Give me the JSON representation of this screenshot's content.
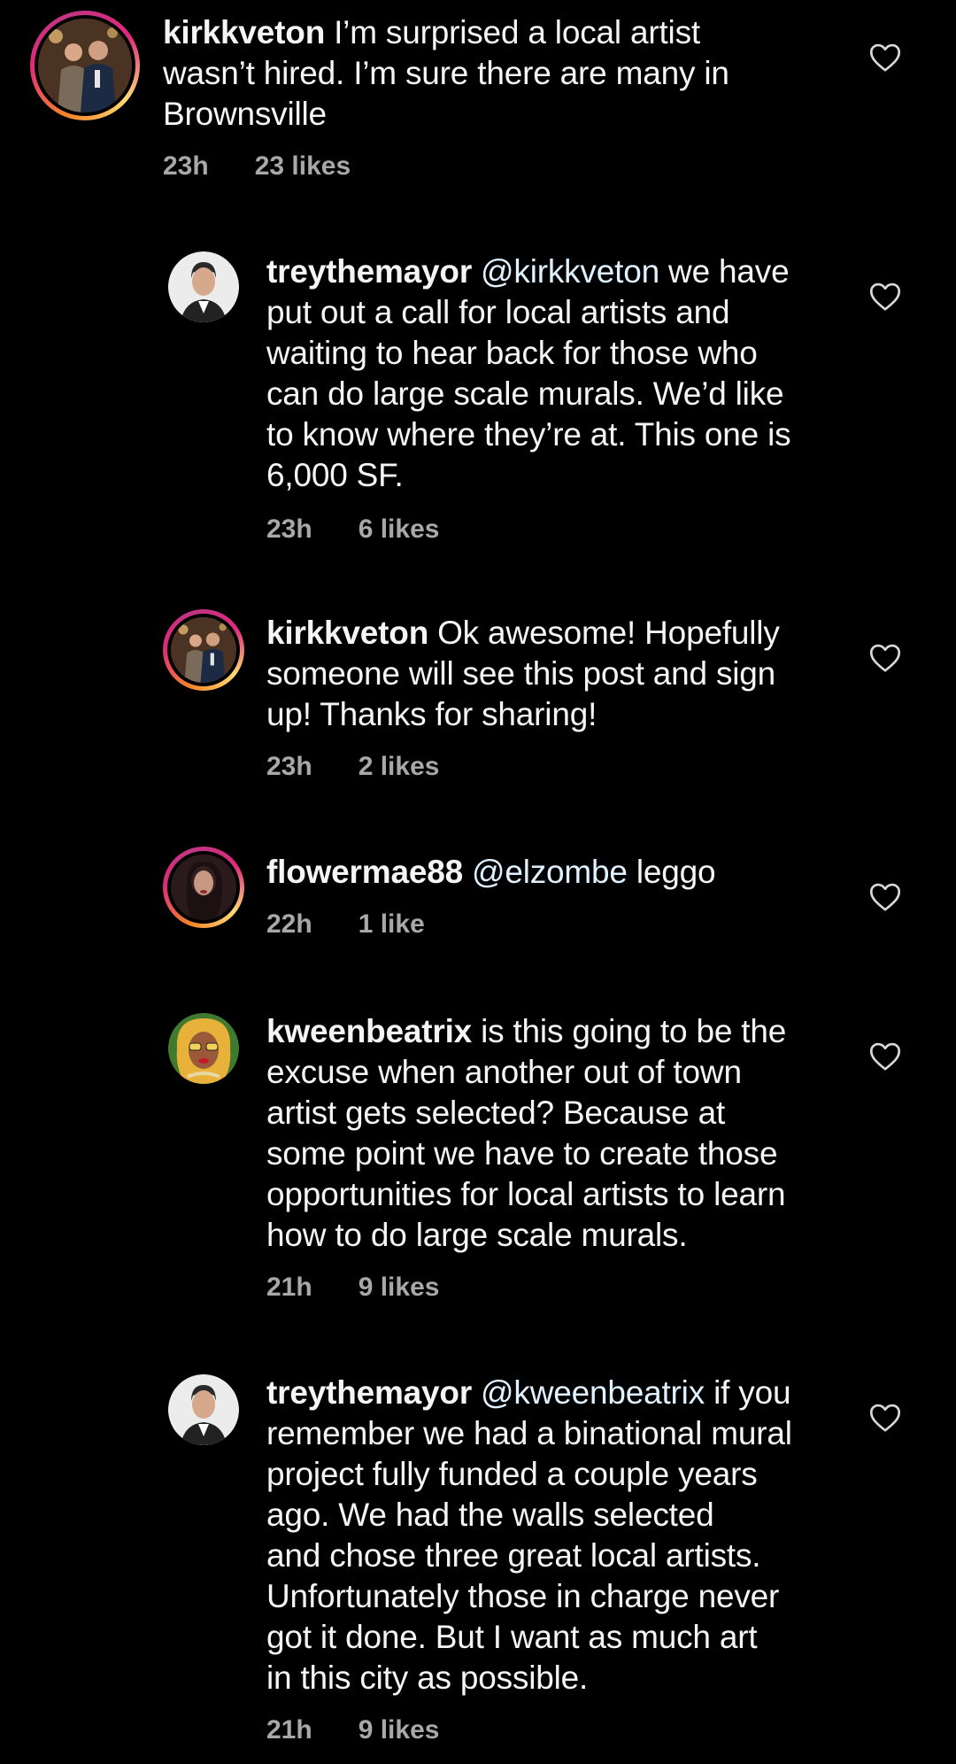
{
  "comments": [
    {
      "username": "kirkkveton",
      "mention": "",
      "lines_first": "I’m surprised a local artist",
      "lines": [
        "wasn’t hired.  I’m sure there are many in",
        "Brownsville"
      ],
      "time": "23h",
      "likes": "23 likes",
      "avatar": "couple-photo"
    },
    {
      "username": "treythemayor",
      "mention": "@kirkkveton",
      "lines_first": "we have",
      "lines": [
        "put out a call for local artists and",
        "waiting to hear back for those who",
        "can do large scale murals. We’d like",
        "to know where they’re at. This one is",
        "6,000 SF."
      ],
      "time": "23h",
      "likes": "6 likes",
      "avatar": "man-portrait"
    },
    {
      "username": "kirkkveton",
      "mention": "",
      "lines_first": "Ok awesome!  Hopefully",
      "lines": [
        "someone will see this post and sign",
        "up!  Thanks for sharing!"
      ],
      "time": "23h",
      "likes": "2 likes",
      "avatar": "couple-photo"
    },
    {
      "username": "flowermae88",
      "mention": "@elzombe",
      "lines_first": "leggo",
      "lines": [],
      "time": "22h",
      "likes": "1 like",
      "avatar": "woman-selfie"
    },
    {
      "username": "kweenbeatrix",
      "mention": "",
      "lines_first": "is this going to be the",
      "lines": [
        "excuse when another out of town",
        "artist gets selected? Because at",
        "some point we have to create those",
        "opportunities for local artists to learn",
        "how to do large scale murals."
      ],
      "time": "21h",
      "likes": "9 likes",
      "avatar": "drag-queen-portrait"
    },
    {
      "username": "treythemayor",
      "mention": "@kweenbeatrix",
      "lines_first": "if you",
      "lines": [
        "remember we had a binational mural",
        "project fully funded a couple years",
        "ago. We had the walls selected",
        "and chose three great local artists.",
        "Unfortunately those in charge never",
        "got it done.  But I want as much art",
        "in this city as possible."
      ],
      "time": "21h",
      "likes": "9 likes",
      "avatar": "man-portrait"
    }
  ],
  "icons": {
    "like": "heart-outline-icon"
  },
  "colors": {
    "background": "#000000",
    "text": "#f5f5f5",
    "meta": "#a8a8a8",
    "mention": "#e0f1ff"
  }
}
